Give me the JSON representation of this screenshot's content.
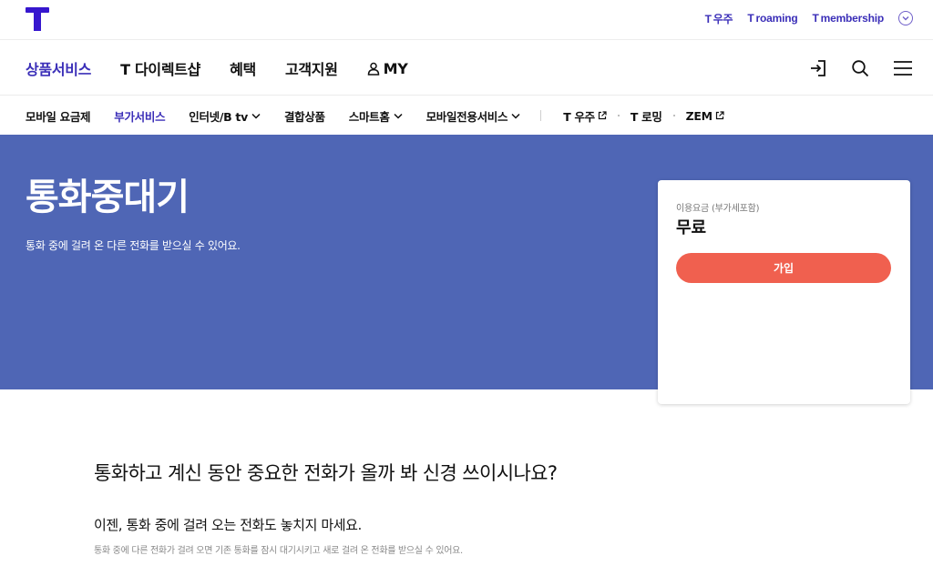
{
  "brand": {
    "accent": "#3617ce",
    "hero_bg": "#4f66b5",
    "cta": "#f0604f"
  },
  "util_links": [
    {
      "mark": "T",
      "label": "우주"
    },
    {
      "mark": "T",
      "label": "roaming"
    },
    {
      "mark": "T",
      "label": "membership"
    }
  ],
  "gnb": {
    "items": [
      "상품서비스",
      "T 다이렉트샵",
      "혜택",
      "고객지원",
      "MY"
    ],
    "icons": [
      "login-icon",
      "search-icon",
      "menu-icon"
    ]
  },
  "lnb": {
    "items": [
      "모바일 요금제",
      "부가서비스",
      "인터넷/B tv",
      "결합상품",
      "스마트홈",
      "모바일전용서비스"
    ],
    "external": [
      "T 우주",
      "T 로밍",
      "ZEM"
    ]
  },
  "hero": {
    "title": "통화중대기",
    "desc": "통화 중에 걸려 온 다른 전화를 받으실 수 있어요."
  },
  "price": {
    "label": "이용요금 (부가세포함)",
    "value": "무료",
    "join_label": "가입"
  },
  "content": {
    "title": "통화하고 계신 동안 중요한 전화가 올까 봐 신경 쓰이시나요?",
    "sub": "이젠, 통화 중에 걸려 오는 전화도 놓치지 마세요.",
    "small": "통화 중에 다른 전화가 걸려 오면 기존 통화를 잠시 대기시키고 새로 걸려 온 전화를 받으실 수 있어요."
  }
}
